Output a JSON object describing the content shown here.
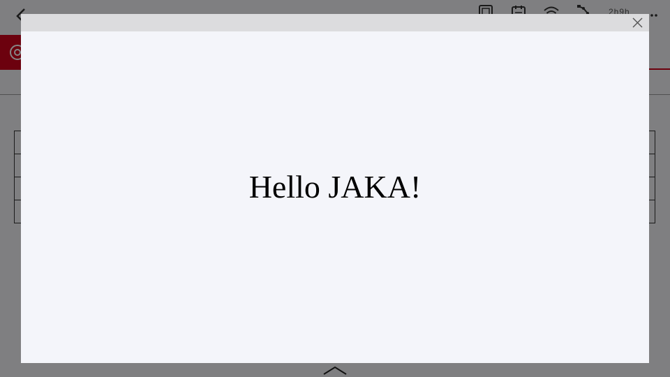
{
  "app": {
    "status": {
      "runtime_text": "2h9h"
    },
    "icons": {
      "back": "back-arrow-icon",
      "tablet": "tablet-icon",
      "calendar": "calendar-icon",
      "wifi": "wifi-icon",
      "robot_arm": "robot-arm-icon",
      "more": "more-dots-icon",
      "settings": "gear-icon",
      "expand": "chevron-up-icon"
    },
    "colors": {
      "accent": "#d0021b",
      "overlay": "rgba(0,0,0,0.48)"
    }
  },
  "modal": {
    "message": "Hello JAKA!",
    "close_icon": "close-icon"
  }
}
